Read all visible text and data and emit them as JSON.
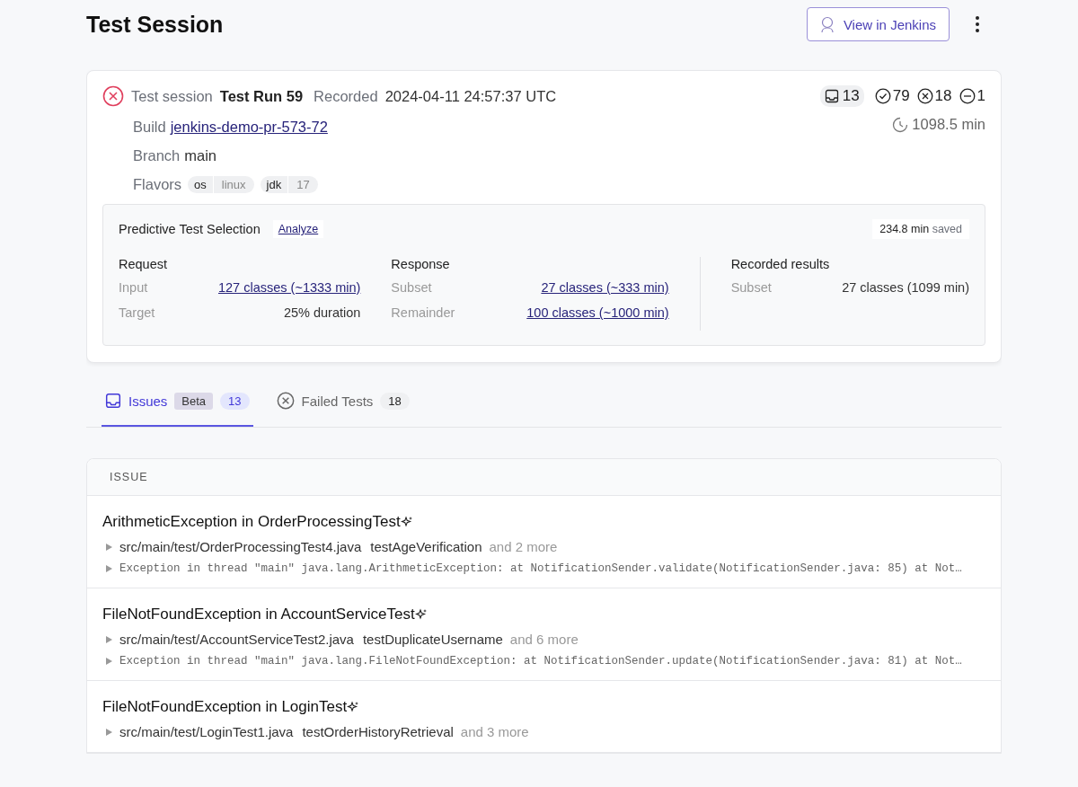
{
  "page": {
    "title": "Test Session",
    "jenkins_button": "View in Jenkins"
  },
  "session": {
    "failed": true,
    "label": "Test session",
    "name": "Test Run 59",
    "recorded_label": "Recorded",
    "recorded": "2024-04-11 24:57:37 UTC",
    "build_label": "Build",
    "build": "jenkins-demo-pr-573-72",
    "branch_label": "Branch",
    "branch": "main",
    "flavors_label": "Flavors",
    "flavors": [
      {
        "key": "os",
        "value": "linux"
      },
      {
        "key": "jdk",
        "value": "17"
      }
    ],
    "stats": [
      {
        "kind": "issues",
        "count": "13"
      },
      {
        "kind": "passed",
        "count": "79"
      },
      {
        "kind": "failed",
        "count": "18"
      },
      {
        "kind": "skipped",
        "count": "1"
      }
    ],
    "duration": "1098.5 min"
  },
  "pts": {
    "title": "Predictive Test Selection",
    "analyze": "Analyze",
    "saved_value": "234.8 min",
    "saved_label": "saved",
    "columns": [
      {
        "heading": "Request",
        "rows": [
          {
            "label": "Input",
            "value": "127 classes (~1333 min)",
            "link": true
          },
          {
            "label": "Target",
            "value": "25% duration",
            "link": false
          }
        ]
      },
      {
        "heading": "Response",
        "rows": [
          {
            "label": "Subset",
            "value": "27 classes (~333 min)",
            "link": true
          },
          {
            "label": "Remainder",
            "value": "100 classes (~1000 min)",
            "link": true
          }
        ]
      },
      {
        "heading": "Recorded results",
        "rows": [
          {
            "label": "Subset",
            "value": "27 classes (1099 min)",
            "link": false
          }
        ]
      }
    ]
  },
  "tabs": [
    {
      "kind": "issues",
      "label": "Issues",
      "badge": "Beta",
      "count": "13",
      "selected": true
    },
    {
      "kind": "failed",
      "label": "Failed Tests",
      "count": "18",
      "selected": false
    }
  ],
  "issues": {
    "column": "ISSUE",
    "rows": [
      {
        "title": "ArithmeticException in OrderProcessingTest",
        "file": "src/main/test/OrderProcessingTest4.java",
        "test": "testAgeVerification",
        "more": "and 2 more",
        "trace": "Exception in thread \"main\" java.lang.ArithmeticException: at NotificationSender.validate(NotificationSender.java: 85) at Not…"
      },
      {
        "title": "FileNotFoundException in AccountServiceTest",
        "file": "src/main/test/AccountServiceTest2.java",
        "test": "testDuplicateUsername",
        "more": "and 6 more",
        "trace": "Exception in thread \"main\" java.lang.FileNotFoundException: at NotificationSender.update(NotificationSender.java: 81) at Not…"
      },
      {
        "title": "FileNotFoundException in LoginTest",
        "file": "src/main/test/LoginTest1.java",
        "test": "testOrderHistoryRetrieval",
        "more": "and 3 more"
      }
    ]
  }
}
